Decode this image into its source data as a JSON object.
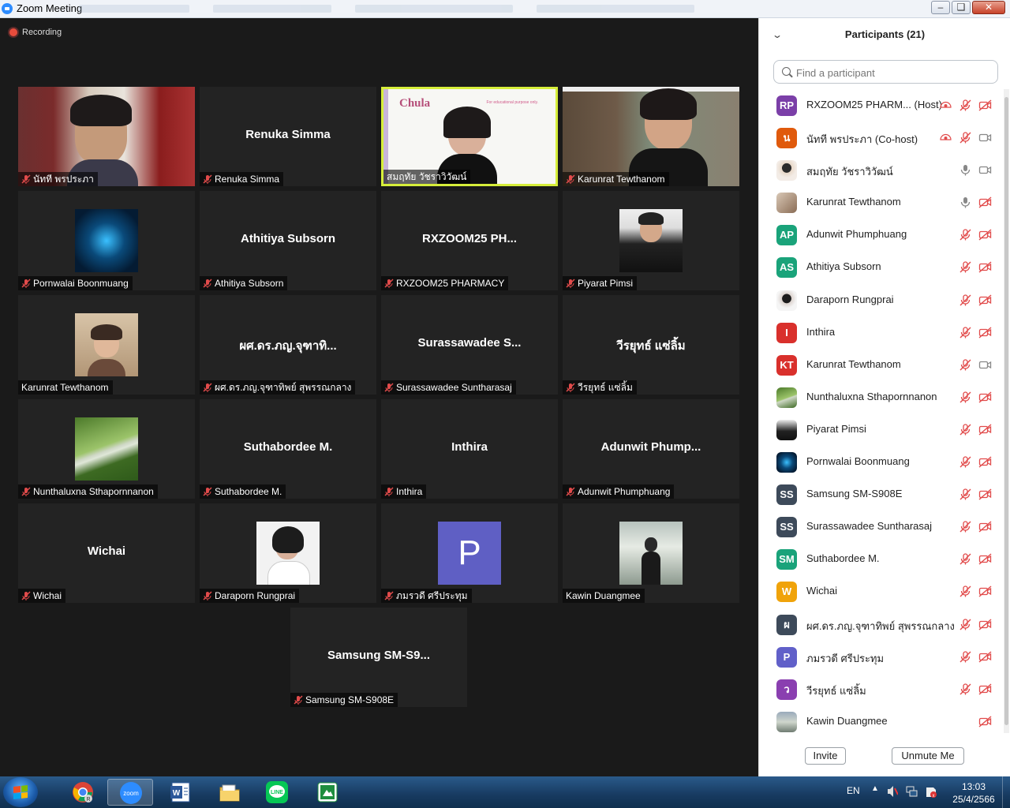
{
  "window": {
    "title": "Zoom Meeting"
  },
  "recording": {
    "label": "Recording"
  },
  "tiles": [
    {
      "kind": "video",
      "bigname": "",
      "label": "นัทที พรประภา",
      "muted": true
    },
    {
      "kind": "name",
      "bigname": "Renuka Simma",
      "label": "Renuka Simma",
      "muted": true
    },
    {
      "kind": "video",
      "bigname": "",
      "label": "สมฤทัย วัชราวิวัฒน์",
      "muted": false,
      "slide_logo": "Chula",
      "slide_note": "For educational purpose only."
    },
    {
      "kind": "video",
      "bigname": "",
      "label": "Karunrat Tewthanom",
      "muted": true
    },
    {
      "kind": "avatar",
      "bigname": "",
      "label": "Pornwalai Boonmuang",
      "muted": true
    },
    {
      "kind": "name",
      "bigname": "Athitiya Subsorn",
      "label": "Athitiya Subsorn",
      "muted": true
    },
    {
      "kind": "name",
      "bigname": "RXZOOM25 PH...",
      "label": "RXZOOM25 PHARMACY",
      "muted": true
    },
    {
      "kind": "avatar",
      "bigname": "",
      "label": "Piyarat Pimsi",
      "muted": true
    },
    {
      "kind": "avatar",
      "bigname": "",
      "label": "Karunrat Tewthanom",
      "muted": false
    },
    {
      "kind": "name",
      "bigname": "ผศ.ดร.ภญ.จุฑาทิ...",
      "label": "ผศ.ดร.ภญ.จุฑาทิพย์ สุพรรณกลาง",
      "muted": true
    },
    {
      "kind": "name",
      "bigname": "Surassawadee S...",
      "label": "Surassawadee Suntharasaj",
      "muted": true
    },
    {
      "kind": "name",
      "bigname": "วีรยุทธ์ แซ่ลิ้ม",
      "label": "วีรยุทธ์ แซ่ลิ้ม",
      "muted": true
    },
    {
      "kind": "avatar",
      "bigname": "",
      "label": "Nunthaluxna Sthapornnanon",
      "muted": true
    },
    {
      "kind": "name",
      "bigname": "Suthabordee M.",
      "label": "Suthabordee M.",
      "muted": true
    },
    {
      "kind": "name",
      "bigname": "Inthira",
      "label": "Inthira",
      "muted": true
    },
    {
      "kind": "name",
      "bigname": "Adunwit Phump...",
      "label": "Adunwit Phumphuang",
      "muted": true
    },
    {
      "kind": "name",
      "bigname": "Wichai",
      "label": "Wichai",
      "muted": true
    },
    {
      "kind": "avatar",
      "bigname": "",
      "label": "Daraporn Rungprai",
      "muted": true
    },
    {
      "kind": "letter",
      "bigname": "",
      "letter": "P",
      "label": "ภมรวดี ศรีประทุม",
      "muted": true
    },
    {
      "kind": "avatar",
      "bigname": "",
      "label": "Kawin Duangmee",
      "muted": false
    },
    {
      "kind": "name",
      "bigname": "Samsung SM-S9...",
      "label": "Samsung SM-S908E",
      "muted": true
    }
  ],
  "panel": {
    "title": "Participants (21)",
    "search_placeholder": "Find a participant",
    "participants": [
      {
        "initials": "RP",
        "color": "#7b3fa8",
        "name": "RXZOOM25 PHARM... (Host)",
        "rec": true,
        "mic": "muted",
        "cam": "off"
      },
      {
        "initials": "น",
        "color": "#e05a0c",
        "name": "นัทที พรประภา (Co-host)",
        "rec": true,
        "mic": "muted",
        "cam": "on"
      },
      {
        "initials": "",
        "color": "photo-1",
        "name": "สมฤทัย วัชราวิวัฒน์",
        "rec": false,
        "mic": "on",
        "cam": "on"
      },
      {
        "initials": "",
        "color": "photo-2",
        "name": "Karunrat Tewthanom",
        "rec": false,
        "mic": "on",
        "cam": "off"
      },
      {
        "initials": "AP",
        "color": "#1aa37a",
        "name": "Adunwit Phumphuang",
        "rec": false,
        "mic": "muted",
        "cam": "off"
      },
      {
        "initials": "AS",
        "color": "#1aa37a",
        "name": "Athitiya Subsorn",
        "rec": false,
        "mic": "muted",
        "cam": "off"
      },
      {
        "initials": "",
        "color": "photo-3",
        "name": "Daraporn Rungprai",
        "rec": false,
        "mic": "muted",
        "cam": "off"
      },
      {
        "initials": "I",
        "color": "#d9302c",
        "name": "Inthira",
        "rec": false,
        "mic": "muted",
        "cam": "off"
      },
      {
        "initials": "KT",
        "color": "#d9302c",
        "name": "Karunrat Tewthanom",
        "rec": false,
        "mic": "muted",
        "cam": "on"
      },
      {
        "initials": "",
        "color": "photo-4",
        "name": "Nunthaluxna Sthapornnanon",
        "rec": false,
        "mic": "muted",
        "cam": "off"
      },
      {
        "initials": "",
        "color": "photo-5",
        "name": "Piyarat Pimsi",
        "rec": false,
        "mic": "muted",
        "cam": "off"
      },
      {
        "initials": "",
        "color": "photo-6",
        "name": "Pornwalai Boonmuang",
        "rec": false,
        "mic": "muted",
        "cam": "off"
      },
      {
        "initials": "SS",
        "color": "#3d4a5a",
        "name": "Samsung SM-S908E",
        "rec": false,
        "mic": "muted",
        "cam": "off"
      },
      {
        "initials": "SS",
        "color": "#3d4a5a",
        "name": "Surassawadee Suntharasaj",
        "rec": false,
        "mic": "muted",
        "cam": "off"
      },
      {
        "initials": "SM",
        "color": "#1aa37a",
        "name": "Suthabordee M.",
        "rec": false,
        "mic": "muted",
        "cam": "off"
      },
      {
        "initials": "W",
        "color": "#f0a30a",
        "name": "Wichai",
        "rec": false,
        "mic": "muted",
        "cam": "off"
      },
      {
        "initials": "ผ",
        "color": "#3d4a5a",
        "name": "ผศ.ดร.ภญ.จุฑาทิพย์ สุพรรณกลาง",
        "rec": false,
        "mic": "muted",
        "cam": "off"
      },
      {
        "initials": "P",
        "color": "#6160c9",
        "name": "ภมรวดี ศรีประทุม",
        "rec": false,
        "mic": "muted",
        "cam": "off"
      },
      {
        "initials": "ว",
        "color": "#8a3fb0",
        "name": "วีรยุทธ์ แซ่ลิ้ม",
        "rec": false,
        "mic": "muted",
        "cam": "off"
      },
      {
        "initials": "",
        "color": "photo-7",
        "name": "Kawin Duangmee",
        "rec": false,
        "mic": "none",
        "cam": "off"
      }
    ],
    "invite_label": "Invite",
    "unmute_label": "Unmute Me"
  },
  "taskbar": {
    "apps": [
      "chrome-icon",
      "zoom-icon",
      "word-icon",
      "explorer-icon",
      "line-icon",
      "sheet-icon"
    ],
    "zoom_label": "zoom",
    "line_label": "LINE",
    "lang": "EN",
    "time": "13:03",
    "date": "25/4/2566"
  }
}
